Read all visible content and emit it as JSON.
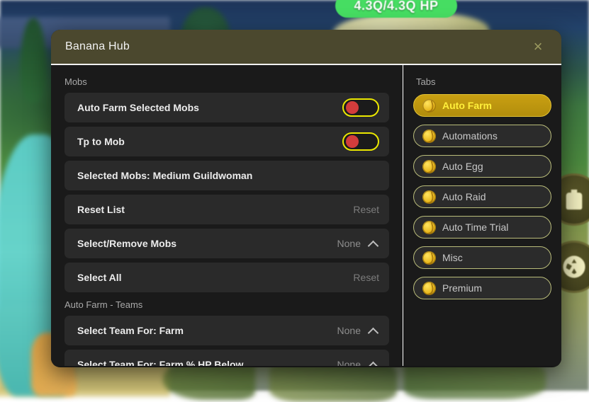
{
  "game": {
    "hp_label": "4.3Q/4.3Q HP",
    "hp_color": "#46dd62",
    "buttons": [
      {
        "name": "backpack-icon"
      },
      {
        "name": "wheel-icon"
      }
    ]
  },
  "window": {
    "title": "Banana Hub",
    "close_label": "×",
    "titlebar_color": "#4b482e"
  },
  "content": {
    "sections": [
      {
        "label": "Mobs",
        "rows": [
          {
            "label": "Auto Farm Selected Mobs",
            "control": "toggle",
            "state": "off"
          },
          {
            "label": "Tp to Mob",
            "control": "toggle",
            "state": "off"
          },
          {
            "label": "Selected Mobs: Medium Guildwoman",
            "control": "none"
          },
          {
            "label": "Reset List",
            "control": "text",
            "value": "Reset"
          },
          {
            "label": "Select/Remove Mobs",
            "control": "dropdown",
            "value": "None"
          },
          {
            "label": "Select All",
            "control": "text",
            "value": "Reset"
          }
        ]
      },
      {
        "label": "Auto Farm - Teams",
        "rows": [
          {
            "label": "Select Team For: Farm",
            "control": "dropdown",
            "value": "None"
          },
          {
            "label": "Select Team For: Farm % HP Below",
            "control": "dropdown",
            "value": "None"
          }
        ]
      }
    ]
  },
  "tabs": {
    "label": "Tabs",
    "items": [
      {
        "label": "Auto Farm",
        "active": true
      },
      {
        "label": "Automations",
        "active": false
      },
      {
        "label": "Auto Egg",
        "active": false
      },
      {
        "label": "Auto Raid",
        "active": false
      },
      {
        "label": "Auto Time Trial",
        "active": false
      },
      {
        "label": "Misc",
        "active": false
      },
      {
        "label": "Premium",
        "active": false
      }
    ]
  },
  "colors": {
    "accent_yellow": "#ebe800",
    "toggle_knob_red": "#d23c3c",
    "active_tab_text": "#ffef3a",
    "panel_bg": "#1a1a1a",
    "row_bg": "#2a2a2a"
  }
}
